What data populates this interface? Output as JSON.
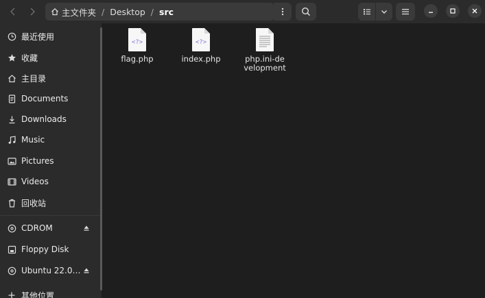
{
  "header": {
    "path": [
      {
        "label": "主文件夹"
      },
      {
        "label": "Desktop"
      },
      {
        "label": "src"
      }
    ],
    "path_separator": "/"
  },
  "sidebar": {
    "items": [
      {
        "label": "最近使用",
        "icon": "clock-icon"
      },
      {
        "label": "收藏",
        "icon": "star-icon"
      },
      {
        "label": "主目录",
        "icon": "home-icon"
      },
      {
        "label": "Documents",
        "icon": "document-icon"
      },
      {
        "label": "Downloads",
        "icon": "download-icon"
      },
      {
        "label": "Music",
        "icon": "music-icon"
      },
      {
        "label": "Pictures",
        "icon": "picture-icon"
      },
      {
        "label": "Videos",
        "icon": "video-icon"
      },
      {
        "label": "回收站",
        "icon": "trash-icon"
      }
    ],
    "devices": [
      {
        "label": "CDROM",
        "icon": "disc-icon",
        "eject": true
      },
      {
        "label": "Floppy Disk",
        "icon": "drive-icon",
        "eject": false
      },
      {
        "label": "Ubuntu 22.0…",
        "icon": "disc-icon",
        "eject": true
      }
    ],
    "other_locations": {
      "label": "其他位置",
      "icon": "plus-icon"
    }
  },
  "files": [
    {
      "name": "flag.php",
      "type": "php-file",
      "badge": "<?>"
    },
    {
      "name": "index.php",
      "type": "php-file",
      "badge": "<?>"
    },
    {
      "name": "php.ini-development",
      "type": "text-file"
    }
  ],
  "colors": {
    "headerbar": "#2b2b2b",
    "sidebar": "#2b2b2b",
    "content": "#1e1e1e",
    "php_badge": "#8a75d6",
    "button": "#3a3a3a"
  }
}
